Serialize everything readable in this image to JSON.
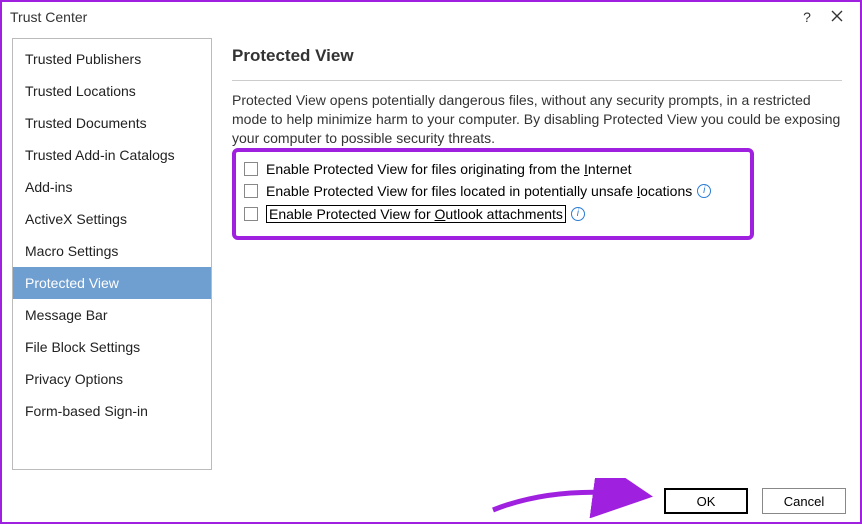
{
  "window": {
    "title": "Trust Center"
  },
  "sidebar": {
    "items": [
      {
        "label": "Trusted Publishers"
      },
      {
        "label": "Trusted Locations"
      },
      {
        "label": "Trusted Documents"
      },
      {
        "label": "Trusted Add-in Catalogs"
      },
      {
        "label": "Add-ins"
      },
      {
        "label": "ActiveX Settings"
      },
      {
        "label": "Macro Settings"
      },
      {
        "label": "Protected View"
      },
      {
        "label": "Message Bar"
      },
      {
        "label": "File Block Settings"
      },
      {
        "label": "Privacy Options"
      },
      {
        "label": "Form-based Sign-in"
      }
    ],
    "selected_index": 7
  },
  "main": {
    "heading": "Protected View",
    "description": "Protected View opens potentially dangerous files, without any security prompts, in a restricted mode to help minimize harm to your computer. By disabling Protected View you could be exposing your computer to possible security threats.",
    "options": [
      {
        "pre": "Enable Protected View for files originating from the ",
        "u": "I",
        "post": "nternet",
        "checked": false,
        "info": false
      },
      {
        "pre": "Enable Protected View for files located in potentially unsafe ",
        "u": "l",
        "post": "ocations",
        "checked": false,
        "info": true
      },
      {
        "pre": "Enable Protected View for ",
        "u": "O",
        "post": "utlook attachments",
        "checked": false,
        "info": true
      }
    ]
  },
  "footer": {
    "ok": "OK",
    "cancel": "Cancel"
  }
}
